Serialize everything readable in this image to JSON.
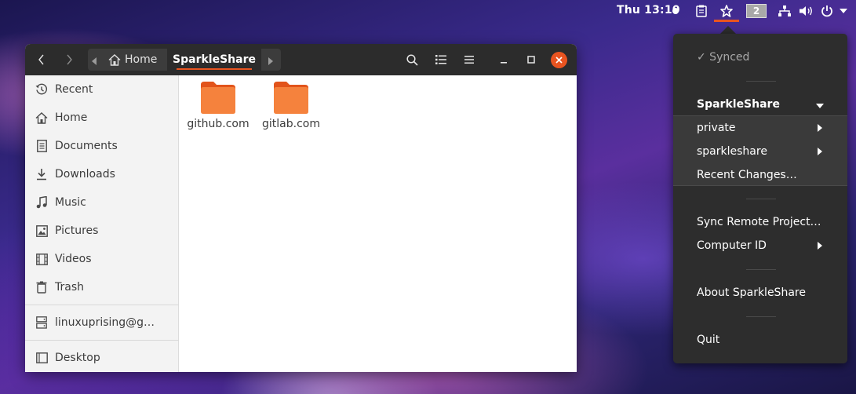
{
  "topbar": {
    "clock": "Thu 13:10",
    "workspace": "2",
    "tray_icons": [
      "notification-dot-icon",
      "clipboard-icon",
      "sparkleshare-icon",
      "network-icon",
      "volume-icon",
      "power-icon"
    ]
  },
  "window": {
    "path": {
      "home_label": "Home",
      "current_label": "SparkleShare"
    },
    "sidebar": {
      "items": [
        {
          "label": "Recent",
          "icon": "clock-icon"
        },
        {
          "label": "Home",
          "icon": "home-icon"
        },
        {
          "label": "Documents",
          "icon": "document-icon"
        },
        {
          "label": "Downloads",
          "icon": "download-icon"
        },
        {
          "label": "Music",
          "icon": "music-icon"
        },
        {
          "label": "Pictures",
          "icon": "picture-icon"
        },
        {
          "label": "Videos",
          "icon": "video-icon"
        },
        {
          "label": "Trash",
          "icon": "trash-icon"
        },
        {
          "label": "linuxuprising@g…",
          "icon": "network-drive-icon"
        },
        {
          "label": "Desktop",
          "icon": "desktop-icon"
        }
      ]
    },
    "folders": [
      {
        "name": "github.com"
      },
      {
        "name": "gitlab.com"
      }
    ]
  },
  "menu": {
    "status": "✓ Synced",
    "app_title": "SparkleShare",
    "sub_items": [
      {
        "label": "private",
        "has_submenu": true
      },
      {
        "label": "sparkleshare",
        "has_submenu": true
      },
      {
        "label": "Recent Changes…",
        "has_submenu": false
      }
    ],
    "sync_remote": "Sync Remote Project…",
    "computer_id": "Computer ID",
    "about": "About SparkleShare",
    "quit": "Quit"
  },
  "colors": {
    "accent": "#e95420",
    "folder": "#f5823d",
    "headerbar": "#2c2c2c",
    "menu_bg": "#2d2d2d"
  }
}
